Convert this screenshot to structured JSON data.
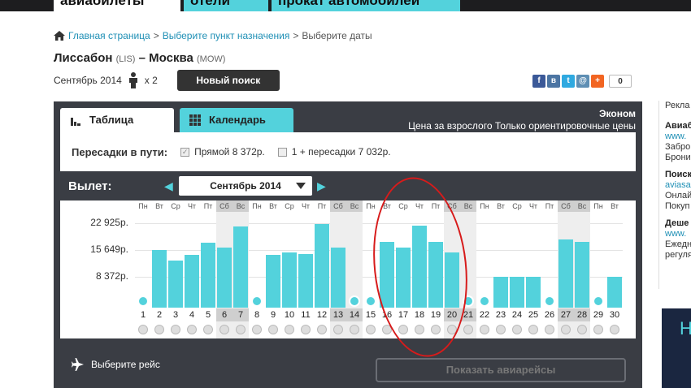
{
  "top_tabs": [
    {
      "label": "авиабилеты"
    },
    {
      "label": "отели"
    },
    {
      "label": "прокат автомобилей"
    }
  ],
  "breadcrumb": {
    "home": "Главная страница",
    "sep1": ">",
    "step2": "Выберите пункт назначения",
    "sep2": ">",
    "current": "Выберите даты"
  },
  "route": {
    "from": "Лиссабон",
    "from_code": "(LIS)",
    "dash": "–",
    "to": "Москва",
    "to_code": "(MOW)"
  },
  "subline": {
    "month": "Сентябрь 2014",
    "passengers": "x 2",
    "new_search": "Новый поиск"
  },
  "share": {
    "icons": [
      "facebook-icon",
      "vk-icon",
      "twitter-icon",
      "mail-icon",
      "plus-icon"
    ],
    "count": "0"
  },
  "panel": {
    "tab_table": "Таблица",
    "tab_calendar": "Календарь",
    "class_label": "Эконом",
    "price_note": "Цена за взрослого Только ориентировочные цены"
  },
  "filters": {
    "label": "Пересадки в пути:",
    "direct": "Прямой 8 372р.",
    "transfer": "1 + пересадки 7 032р."
  },
  "depart": {
    "label": "Вылет:",
    "month": "Сентябрь 2014"
  },
  "chart_data": {
    "type": "bar",
    "y_ticks": [
      "22 925р.",
      "15 649р.",
      "8 372р."
    ],
    "y_tick_values": [
      22925,
      15649,
      8372
    ],
    "weekdays": [
      "Пн",
      "Вт",
      "Ср",
      "Чт",
      "Пт",
      "Сб",
      "Вс",
      "Пн",
      "Вт",
      "Ср",
      "Чт",
      "Пт",
      "Сб",
      "Вс",
      "Пн",
      "Вт",
      "Ср",
      "Чт",
      "Пт",
      "Сб",
      "Вс",
      "Пн",
      "Вт",
      "Ср",
      "Чт",
      "Пт",
      "Сб",
      "Вс",
      "Пн",
      "Вт"
    ],
    "categories": [
      "1",
      "2",
      "3",
      "4",
      "5",
      "6",
      "7",
      "8",
      "9",
      "10",
      "11",
      "12",
      "13",
      "14",
      "15",
      "16",
      "17",
      "18",
      "19",
      "20",
      "21",
      "22",
      "23",
      "24",
      "25",
      "26",
      "27",
      "28",
      "29",
      "30"
    ],
    "weekend": [
      false,
      false,
      false,
      false,
      false,
      true,
      true,
      false,
      false,
      false,
      false,
      false,
      true,
      true,
      false,
      false,
      false,
      false,
      false,
      true,
      true,
      false,
      false,
      false,
      false,
      false,
      true,
      true,
      false,
      false
    ],
    "values": [
      null,
      15649,
      12700,
      14300,
      17700,
      16400,
      22100,
      null,
      14300,
      14900,
      14600,
      22800,
      16400,
      null,
      null,
      17900,
      16200,
      22300,
      17800,
      15000,
      null,
      null,
      8372,
      8372,
      8372,
      null,
      18400,
      17800,
      null,
      8372
    ],
    "ylim": [
      0,
      26000
    ]
  },
  "footer": {
    "select_flight": "Выберите рейс",
    "show_flights": "Показать авиарейсы"
  },
  "sidebar": {
    "ad_label": "Рекла",
    "block1_title": "Авиаб",
    "block1_link": "www.",
    "block1_text1": "Заброн",
    "block1_text2": "Брони",
    "block2_title": "Поиск",
    "block2_link": "aviasa",
    "block2_text1": "Онлай",
    "block2_text2": "Покуп",
    "block3_title": "Деше",
    "block3_link": "www.",
    "block3_text1": "Ежедн",
    "block3_text2": "регуля",
    "promo_glyph": "Н"
  }
}
